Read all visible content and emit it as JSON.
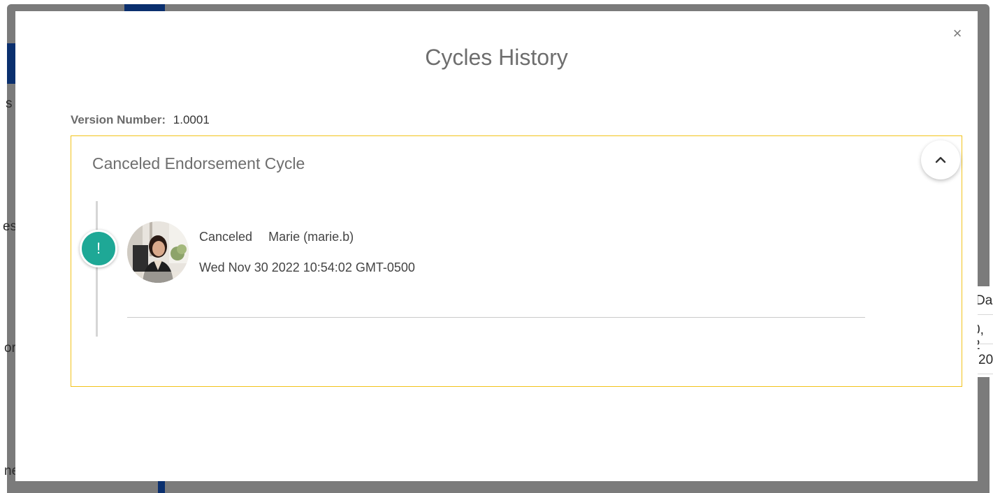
{
  "modal": {
    "title": "Cycles History",
    "close_label": "×",
    "version_label": "Version Number:",
    "version_value": "1.0001"
  },
  "cycle": {
    "title": "Canceled Endorsement Cycle",
    "collapse_icon": "chevron-up-icon",
    "event": {
      "status_icon": "!",
      "status": "Canceled",
      "user": "Marie (marie.b)",
      "timestamp": "Wed Nov 30 2022 10:54:02 GMT-0500"
    }
  },
  "background_fragments": {
    "left_1": "s",
    "left_2": "es",
    "left_3": "or",
    "left_4": "ne",
    "right_1": "Da",
    "right_2": "0, 2",
    "right_3": "20"
  },
  "colors": {
    "accent_border": "#f2c31b",
    "status_teal": "#1ea896",
    "backdrop_gray": "#7b7b7b",
    "background_navy": "#0a2f6e"
  }
}
